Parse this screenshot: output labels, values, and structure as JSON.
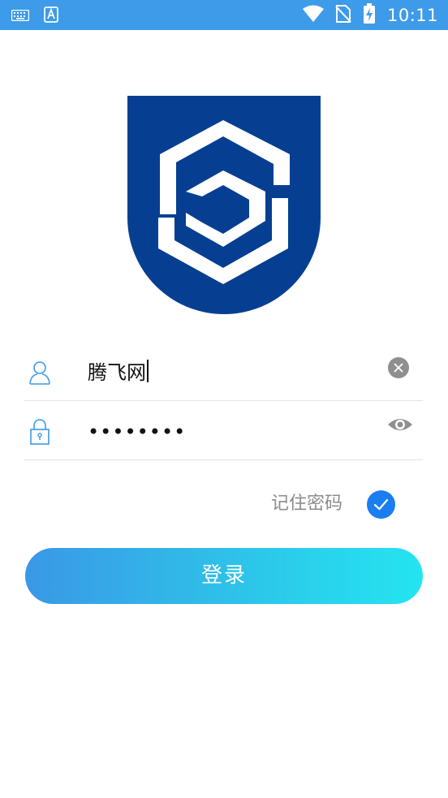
{
  "status_bar": {
    "time": "10:11",
    "left_icons": [
      "keyboard-icon",
      "app-a-icon"
    ],
    "right_icons": [
      "wifi-icon",
      "no-sim-icon",
      "battery-charging-icon"
    ],
    "background": "#3d9be9"
  },
  "logo": {
    "colors": {
      "shield": "#063f92",
      "mark": "#ffffff"
    }
  },
  "login_form": {
    "username": {
      "value": "腾飞网",
      "icon": "user-icon",
      "action_icon": "clear-icon"
    },
    "password": {
      "value": "••••••••",
      "icon": "lock-icon",
      "action_icon": "eye-icon"
    },
    "remember_password": {
      "label": "记住密码",
      "checked": true
    },
    "submit_label": "登录"
  },
  "accent_color": "#1a7ef0"
}
